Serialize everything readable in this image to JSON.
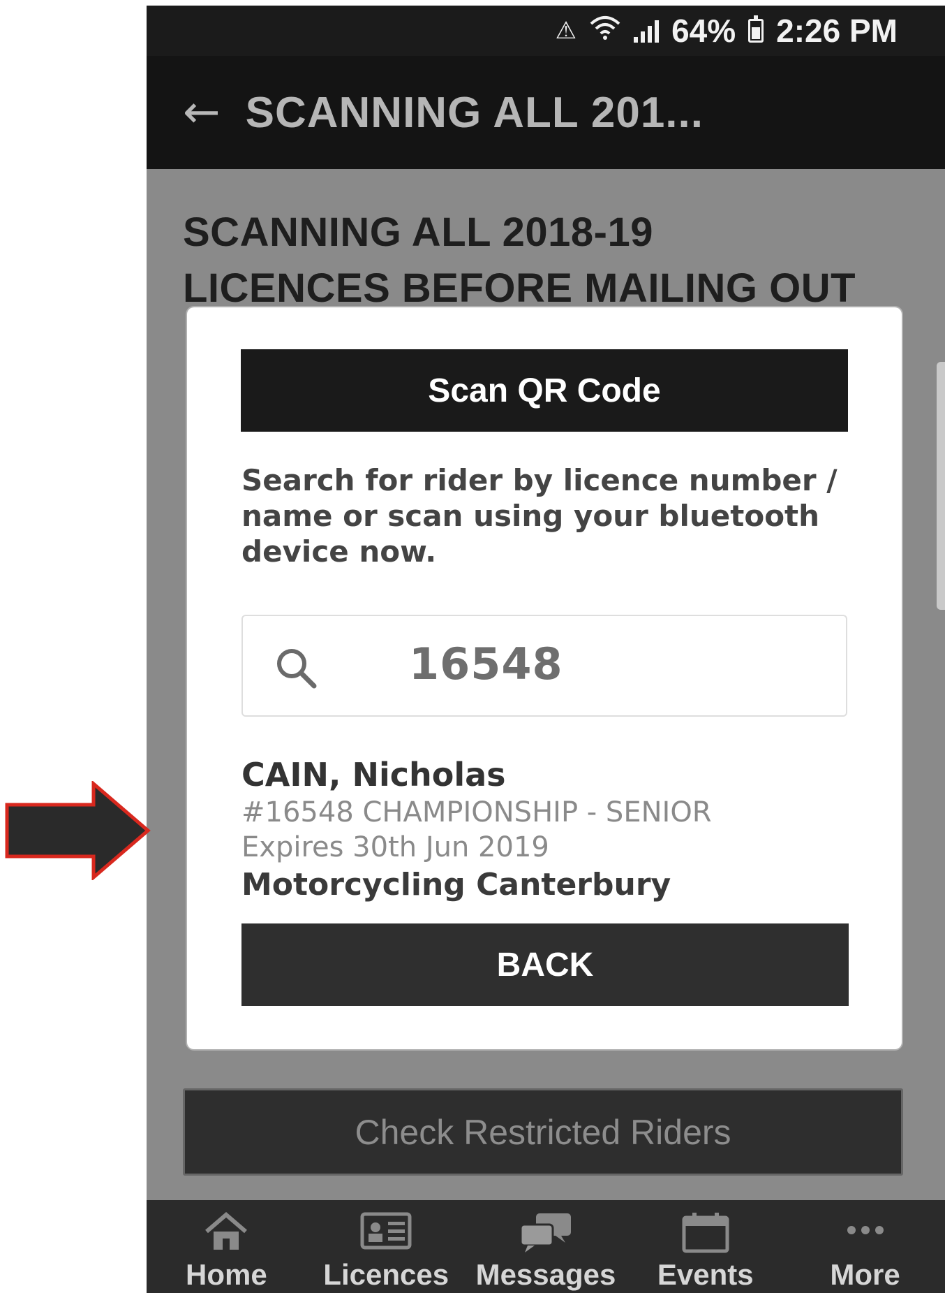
{
  "status_bar": {
    "battery": "64%",
    "time": "2:26 PM",
    "icons": [
      "data-saver-icon",
      "wifi-icon",
      "signal-icon",
      "battery-icon"
    ]
  },
  "app_bar": {
    "back_icon": "arrow-left-icon",
    "title": "SCANNING ALL 201..."
  },
  "page": {
    "title_line1": "SCANNING ALL 2018-19",
    "title_line2": "LICENCES BEFORE MAILING OUT",
    "restricted_button": "Check Restricted Riders"
  },
  "modal": {
    "scan_button": "Scan QR Code",
    "instructions": "Search for rider by licence number / name or scan using your bluetooth device now.",
    "search": {
      "value": "16548",
      "icon": "search-icon"
    },
    "result": {
      "name": "CAIN, Nicholas",
      "licence": "#16548 CHAMPIONSHIP - SENIOR",
      "expiry": "Expires 30th Jun 2019",
      "club": "Motorcycling Canterbury"
    },
    "back_button": "BACK"
  },
  "bottom_nav": {
    "items": [
      {
        "label": "Home",
        "icon": "home-icon"
      },
      {
        "label": "Licences",
        "icon": "id-card-icon"
      },
      {
        "label": "Messages",
        "icon": "chat-bubbles-icon"
      },
      {
        "label": "Events",
        "icon": "calendar-icon"
      },
      {
        "label": "More",
        "icon": "more-dots-icon"
      }
    ]
  },
  "colors": {
    "annotation_arrow_fill": "#2a2a2a",
    "annotation_arrow_stroke": "#d8281e"
  }
}
